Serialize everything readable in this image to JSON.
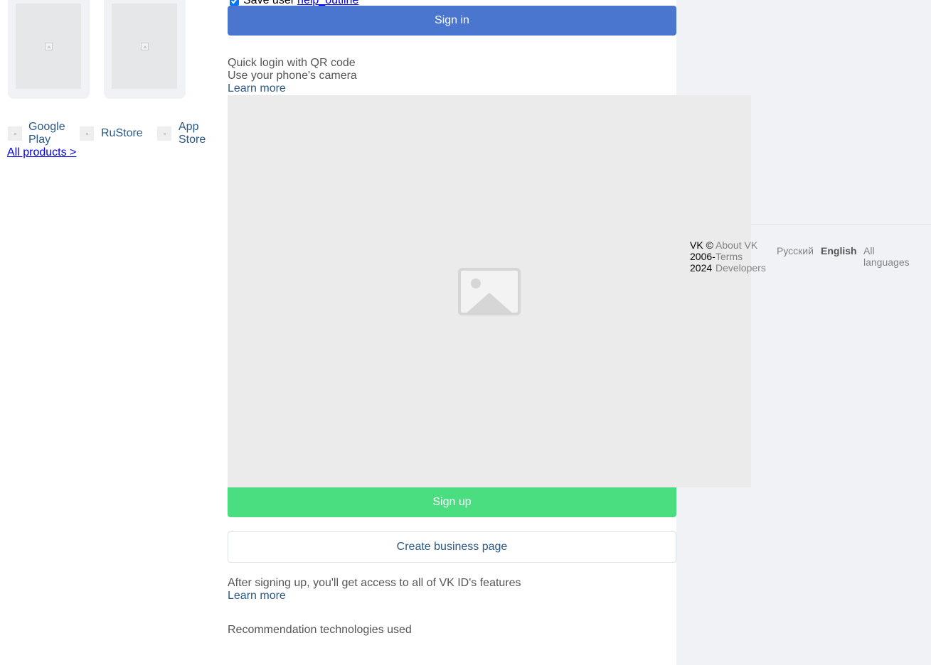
{
  "promo": {
    "cards": [
      {
        "image": "promo-image-broken"
      },
      {
        "image": "promo-image-broken"
      }
    ]
  },
  "stores": [
    {
      "label_line1": "Google",
      "label_line2": "Play",
      "icon": "google-play-icon"
    },
    {
      "label_line1": "RuStore",
      "label_line2": "",
      "icon": "rustore-icon"
    },
    {
      "label_line1": "App",
      "label_line2": "Store",
      "icon": "app-store-icon"
    }
  ],
  "all_products": "All products >",
  "login": {
    "save_user_label": "Save user",
    "save_user_checked": true,
    "help_link": "help_outline",
    "sign_in": "Sign in"
  },
  "qr": {
    "title": "Quick login with QR code",
    "subtitle": "Use your phone's camera",
    "learn_more": "Learn more",
    "image": "qr-code-placeholder"
  },
  "signup": {
    "sign_up": "Sign up",
    "create_business": "Create business page",
    "info": "After signing up, you'll get access to all of VK ID's features",
    "learn_more": "Learn more",
    "recommendation": "Recommendation technologies used"
  },
  "footer": {
    "copyright": "VK © 2006-2024",
    "links": [
      "About VK",
      "Terms",
      "Developers"
    ],
    "languages": [
      "Русский",
      "English",
      "All languages"
    ],
    "active_language": "English"
  },
  "colors": {
    "primary_blue": "#4a76cf",
    "signup_green": "#4bde80",
    "link_blue": "#2a5885",
    "page_bg": "#f0f2f5"
  }
}
